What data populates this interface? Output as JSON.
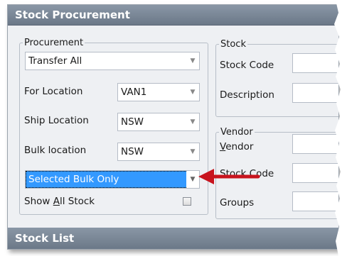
{
  "window": {
    "title": "Stock Procurement",
    "bottom_title": "Stock List"
  },
  "procurement": {
    "legend": "Procurement",
    "mode_value": "Transfer All",
    "for_location_label": "For Location",
    "for_location_value": "VAN1",
    "ship_location_label": "Ship Location",
    "ship_location_value": "NSW",
    "bulk_location_label": "Bulk location",
    "bulk_location_value": "NSW",
    "bulk_filter_value": "Selected Bulk Only",
    "show_all_pre": "Show ",
    "show_all_u": "A",
    "show_all_post": "ll Stock",
    "show_all_checked": false
  },
  "stock": {
    "legend": "Stock",
    "stock_code_label": "Stock Code",
    "description_label": "Description"
  },
  "vendor": {
    "legend": "Vendor",
    "vendor_label_u": "V",
    "vendor_label_rest": "endor",
    "stock_code_label": "Stock Code",
    "groups_label": "Groups"
  },
  "colors": {
    "selection": "#3399ff",
    "annotation_arrow": "#c8141e",
    "header": "#7b8797"
  }
}
